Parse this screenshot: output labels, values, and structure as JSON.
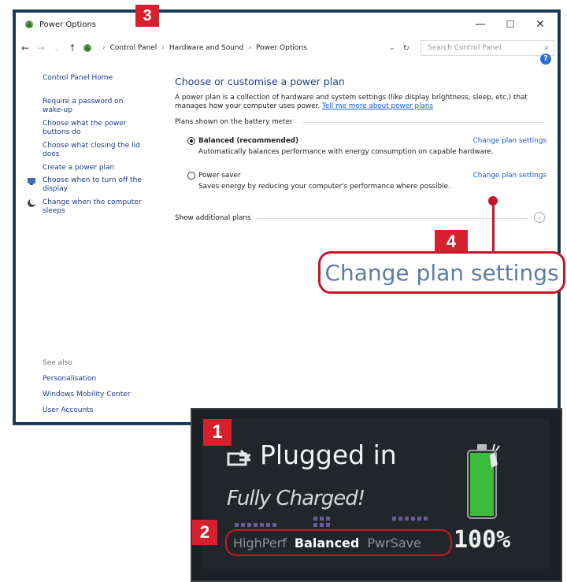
{
  "window": {
    "title": "Power Options",
    "controls": {
      "minimize": "—",
      "maximize": "☐",
      "close": "✕"
    }
  },
  "nav": {
    "breadcrumbs": [
      "Control Panel",
      "Hardware and Sound",
      "Power Options"
    ],
    "search_placeholder": "Search Control Panel"
  },
  "sidebar": {
    "home": "Control Panel Home",
    "items": [
      "Require a password on wake-up",
      "Choose what the power buttons do",
      "Choose what closing the lid does",
      "Create a power plan",
      "Choose when to turn off the display",
      "Change when the computer sleeps"
    ],
    "see_also_label": "See also",
    "see_also": [
      "Personalisation",
      "Windows Mobility Center",
      "User Accounts"
    ]
  },
  "main": {
    "heading": "Choose or customise a power plan",
    "description": "A power plan is a collection of hardware and system settings (like display brightness, sleep, etc.) that manages how your computer uses power.",
    "description_link": "Tell me more about power plans",
    "group_label": "Plans shown on the battery meter",
    "plans": [
      {
        "name": "Balanced (recommended)",
        "desc": "Automatically balances performance with energy consumption on capable hardware.",
        "link": "Change plan settings",
        "selected": true
      },
      {
        "name": "Power saver",
        "desc": "Saves energy by reducing your computer's performance where possible.",
        "link": "Change plan settings",
        "selected": false
      }
    ],
    "additional": "Show additional plans"
  },
  "callouts": {
    "n1": "1",
    "n2": "2",
    "n3": "3",
    "n4": "4",
    "zoom_text": "Change plan settings",
    "color": "#d6202e"
  },
  "widget": {
    "title": "Plugged in",
    "subtitle": "Fully Charged!",
    "percent_text": "100%",
    "charge_level": 1.0,
    "modes": {
      "high": "HighPerf",
      "balanced": "Balanced",
      "saver": "PwrSave"
    },
    "battery_color": "#3dbb3a"
  }
}
